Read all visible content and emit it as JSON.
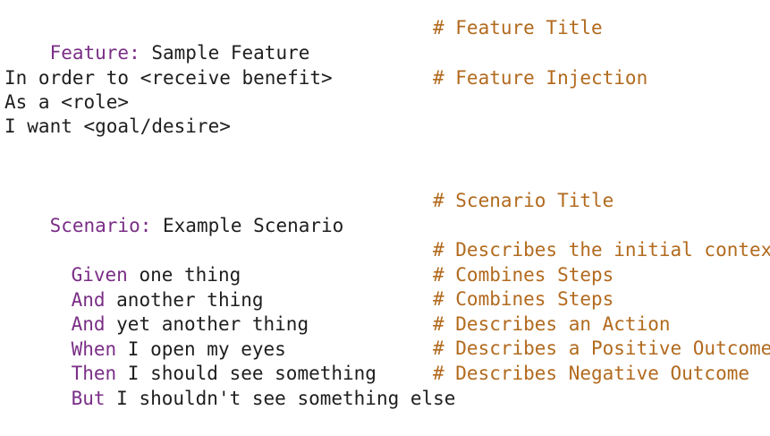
{
  "colors": {
    "keyword": "#7a2e86",
    "text": "#1e1e1e",
    "comment": "#b26a1e",
    "background": "#ffffff"
  },
  "feature": {
    "keyword": "Feature:",
    "title": " Sample Feature",
    "comment": "# Feature Title"
  },
  "injection": {
    "line1": "In order to <receive benefit>",
    "line2": "As a <role>",
    "line3": "I want <goal/desire>",
    "comment": "# Feature Injection"
  },
  "scenario": {
    "keyword": "Scenario:",
    "title": " Example Scenario",
    "comment": "# Scenario Title"
  },
  "steps": [
    {
      "keyword": "Given",
      "text": " one thing",
      "comment": "# Describes the initial context"
    },
    {
      "keyword": "And",
      "text": " another thing",
      "comment": "# Combines Steps"
    },
    {
      "keyword": "And",
      "text": " yet another thing",
      "comment": "# Combines Steps"
    },
    {
      "keyword": "When",
      "text": " I open my eyes",
      "comment": "# Describes an Action"
    },
    {
      "keyword": "Then",
      "text": " I should see something",
      "comment": "# Describes a Positive Outcome"
    },
    {
      "keyword": "But",
      "text": " I shouldn't see something else",
      "comment": "# Describes Negative Outcome"
    }
  ]
}
